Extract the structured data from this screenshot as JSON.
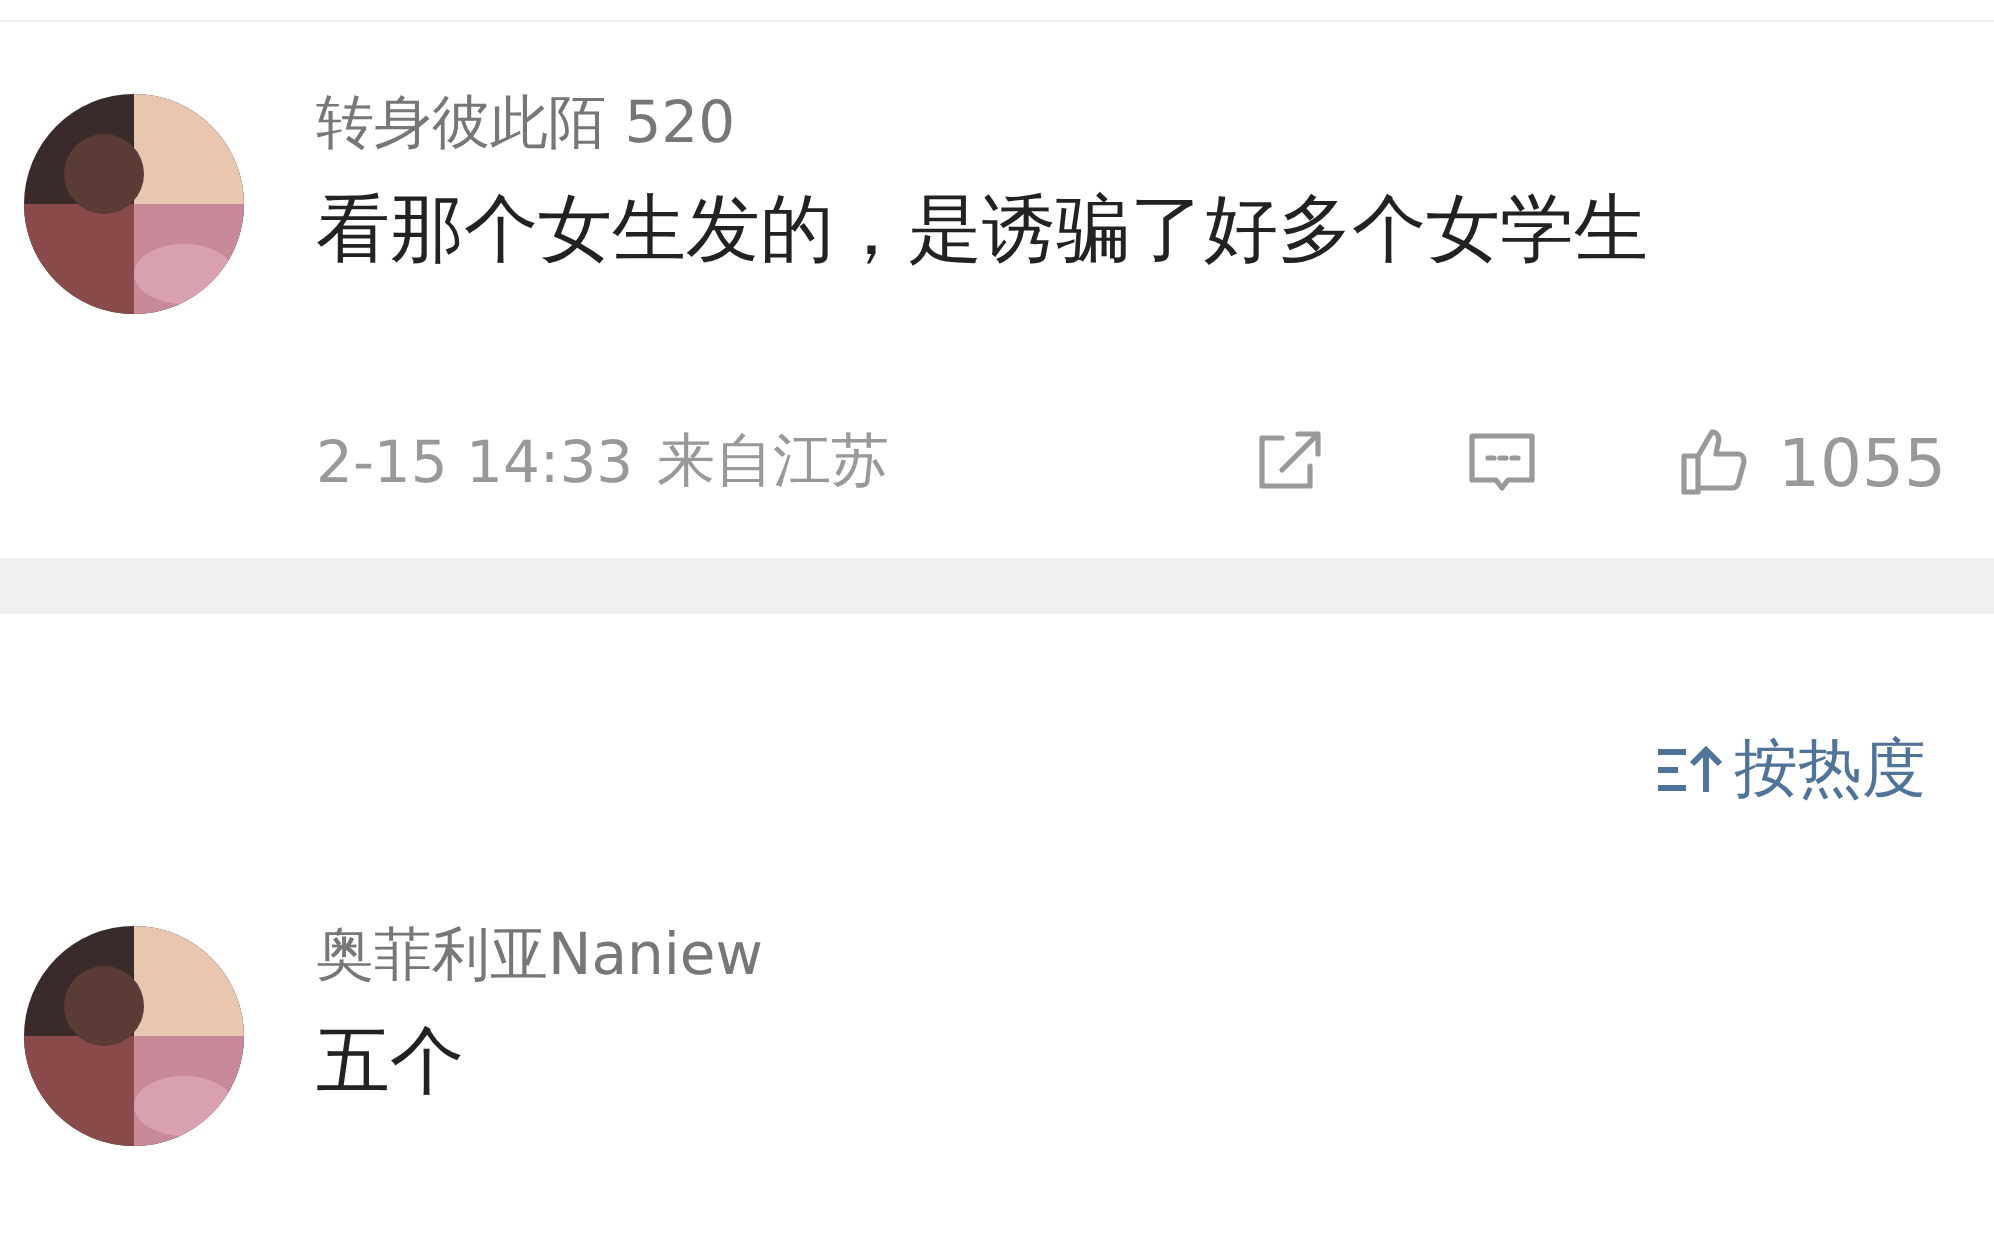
{
  "comments": [
    {
      "author": "转身彼此陌 520",
      "text": "看那个女生发的，是诱骗了好多个女学生",
      "time": "2-15 14:33",
      "location": "来自江苏",
      "likes": "1055"
    },
    {
      "author": "奥菲利亚Naniew",
      "text": "五个"
    }
  ],
  "sort": {
    "label": "按热度"
  }
}
